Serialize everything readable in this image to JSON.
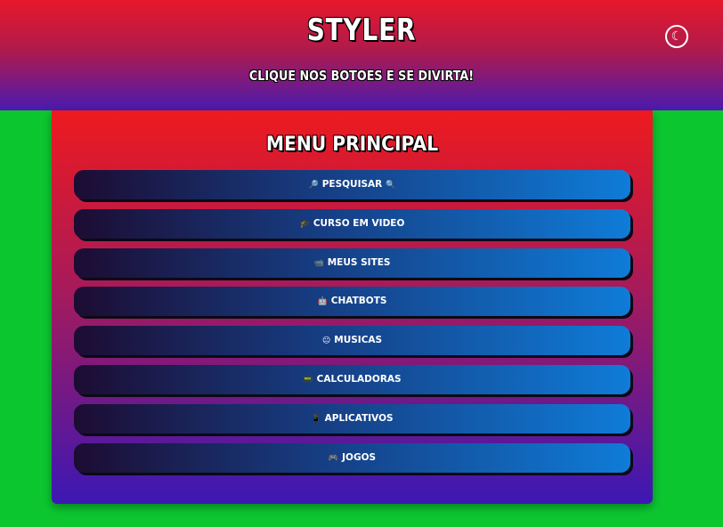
{
  "header": {
    "brand": "STYLER",
    "tagline": "CLIQUE NOS BOTOES E SE DIVIRTA!",
    "theme_toggle_icon": "☾"
  },
  "colors": {
    "page_background": "#0cc630",
    "header_gradient": [
      "#e8182a",
      "#4a1ab0"
    ],
    "card_gradient": [
      "#ee1a1e",
      "#3c18b4"
    ],
    "button_gradient": [
      "#1c0c32",
      "#0f7cd8"
    ]
  },
  "menu": {
    "title": "MENU PRINCIPAL",
    "items": [
      {
        "label": "PESQUISAR",
        "icon": "🔎",
        "icon_after": "🔍",
        "icon_name": "magnifier-icon"
      },
      {
        "label": "CURSO EM VIDEO",
        "icon": "🎓",
        "icon_name": "graduation-cap-icon"
      },
      {
        "label": "MEUS SITES",
        "icon": "📹",
        "icon_name": "camera-icon"
      },
      {
        "label": "CHATBOTS",
        "icon": "🤖",
        "icon_name": "robot-icon"
      },
      {
        "label": "MUSICAS",
        "icon": "😐",
        "icon_name": "face-icon"
      },
      {
        "label": "CALCULADORAS",
        "icon": "📟",
        "icon_name": "calculator-icon"
      },
      {
        "label": "APLICATIVOS",
        "icon": "📱",
        "icon_name": "phone-icon"
      },
      {
        "label": "JOGOS",
        "icon": "🎮",
        "icon_name": "gamepad-icon"
      }
    ]
  }
}
